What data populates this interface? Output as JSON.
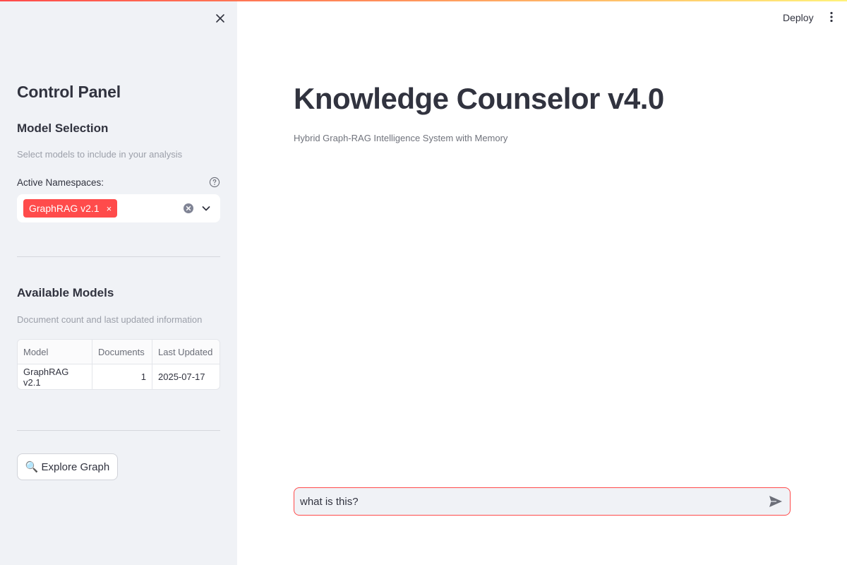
{
  "sidebar": {
    "title": "Control Panel",
    "model_selection": {
      "heading": "Model Selection",
      "caption": "Select models to include in your analysis",
      "namespaces_label": "Active Namespaces:",
      "selected_tags": [
        "GraphRAG v2.1"
      ],
      "tag_remove_glyph": "×"
    },
    "available_models": {
      "heading": "Available Models",
      "caption": "Document count and last updated information",
      "columns": [
        "Model",
        "Documents",
        "Last Updated"
      ],
      "rows": [
        [
          "GraphRAG v2.1",
          "1",
          "2025-07-17"
        ]
      ]
    },
    "explore_button": {
      "icon": "🔍",
      "label": "Explore Graph"
    }
  },
  "header": {
    "deploy_label": "Deploy"
  },
  "main": {
    "title": "Knowledge Counselor v4.0",
    "subtitle": "Hybrid Graph-RAG Intelligence System with Memory",
    "chat_input": {
      "value": "what is this?"
    }
  },
  "colors": {
    "accent": "#ff4b4b",
    "sidebar_bg": "#f0f2f6",
    "text": "#31333f"
  }
}
